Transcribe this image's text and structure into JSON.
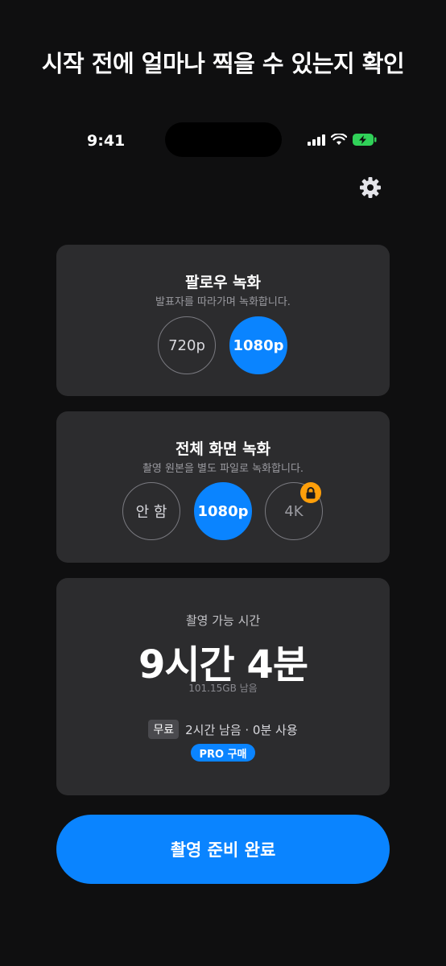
{
  "headline": "시작 전에 얼마나 찍을 수 있는지 확인",
  "status": {
    "time": "9:41",
    "battery_color": "#30d158"
  },
  "settings": {
    "icon": "gear-icon"
  },
  "follow_recording": {
    "title": "팔로우 녹화",
    "subtitle": "발표자를 따라가며 녹화합니다.",
    "options": [
      "720p",
      "1080p"
    ],
    "selected": "1080p"
  },
  "full_recording": {
    "title": "전체 화면 녹화",
    "subtitle": "촬영 원본을 별도 파일로 녹화합니다.",
    "options": [
      "안 함",
      "1080p",
      "4K"
    ],
    "selected": "1080p",
    "locked": "4K"
  },
  "capacity": {
    "label": "촬영 가능 시간",
    "value": "9시간 4분",
    "storage": "101.15GB 남음",
    "free_badge": "무료",
    "usage": "2시간 남음 · 0분 사용",
    "pro_label": "PRO 구매"
  },
  "cta_label": "촬영 준비 완료",
  "colors": {
    "accent": "#0a84ff",
    "lock": "#ff9f0a",
    "card": "#2c2c2e"
  }
}
